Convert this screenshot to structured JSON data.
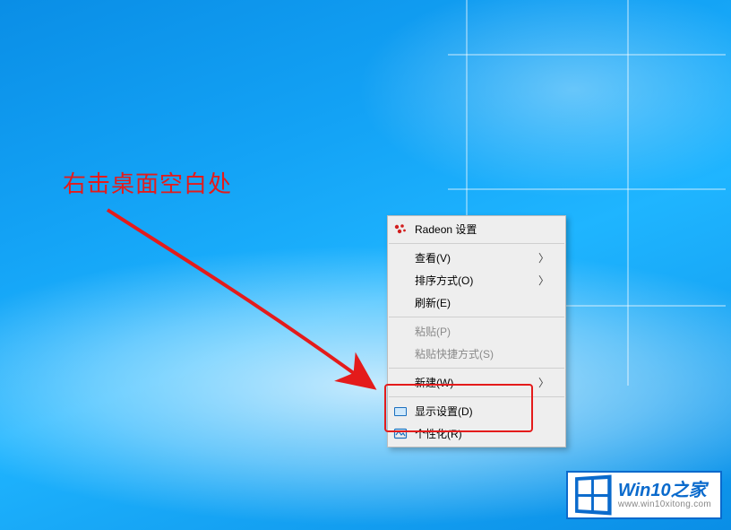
{
  "annotation": {
    "text": "右击桌面空白处",
    "color": "#e41b1b"
  },
  "context_menu": {
    "top_item": {
      "label": "Radeon 设置",
      "icon": "radeon-icon"
    },
    "group1": [
      {
        "label": "查看(V)",
        "submenu": true
      },
      {
        "label": "排序方式(O)",
        "submenu": true
      },
      {
        "label": "刷新(E)",
        "submenu": false
      }
    ],
    "group2": [
      {
        "label": "粘贴(P)",
        "disabled": true
      },
      {
        "label": "粘贴快捷方式(S)",
        "disabled": true
      }
    ],
    "group3": [
      {
        "label": "新建(W)",
        "submenu": true
      }
    ],
    "group4": [
      {
        "label": "显示设置(D)",
        "icon": "display-icon",
        "highlighted": true
      },
      {
        "label": "个性化(R)",
        "icon": "personalize-icon"
      }
    ],
    "submenu_glyph": "〉"
  },
  "watermark": {
    "title_en": "Win10",
    "title_zh": "之家",
    "url": "www.win10xitong.com"
  }
}
